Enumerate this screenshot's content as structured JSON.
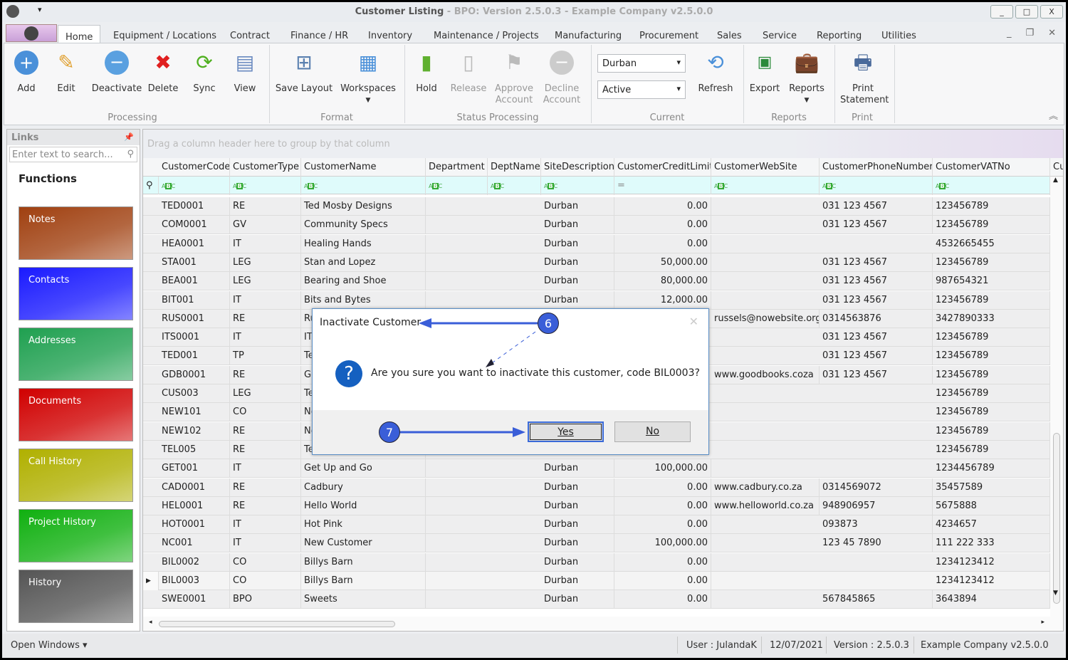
{
  "window": {
    "title": "Customer Listing",
    "subtitle": " - BPO: Version 2.5.0.3 - Example Company v2.5.0.0",
    "minimize": "_",
    "maximize": "□",
    "close": "X"
  },
  "tabs": [
    "Home",
    "Equipment / Locations",
    "Contract",
    "Finance / HR",
    "Inventory",
    "Maintenance / Projects",
    "Manufacturing",
    "Procurement",
    "Sales",
    "Service",
    "Reporting",
    "Utilities"
  ],
  "ribbon": {
    "processing": {
      "label": "Processing",
      "buttons": [
        "Add",
        "Edit",
        "Deactivate",
        "Delete",
        "Sync",
        "View"
      ]
    },
    "format": {
      "label": "Format",
      "buttons": [
        "Save Layout",
        "Workspaces"
      ]
    },
    "status_processing": {
      "label": "Status Processing",
      "buttons": [
        "Hold",
        "Release",
        "Approve Account",
        "Decline Account"
      ]
    },
    "current": {
      "label": "Current",
      "site": "Durban",
      "status": "Active",
      "refresh": "Refresh"
    },
    "reports": {
      "label": "Reports",
      "buttons": [
        "Export",
        "Reports"
      ]
    },
    "print": {
      "label": "Print",
      "buttons": [
        "Print Statement"
      ]
    }
  },
  "links": {
    "title": "Links",
    "search_placeholder": "Enter text to search...",
    "functions_title": "Functions",
    "tiles": [
      {
        "label": "Notes",
        "color": "#a04010"
      },
      {
        "label": "Contacts",
        "color": "#1a1aff"
      },
      {
        "label": "Addresses",
        "color": "#1fa050"
      },
      {
        "label": "Documents",
        "color": "#d00000"
      },
      {
        "label": "Call History",
        "color": "#b0b000"
      },
      {
        "label": "Project History",
        "color": "#10b010"
      },
      {
        "label": "History",
        "color": "#555555"
      }
    ]
  },
  "grid": {
    "group_hint": "Drag a column header here to group by that column",
    "columns": [
      "CustomerCode",
      "CustomerType",
      "CustomerName",
      "Department",
      "DeptName",
      "SiteDescription",
      "CustomerCreditLimit",
      "CustomerWebSite",
      "CustomerPhoneNumber",
      "CustomerVATNo",
      "Cus"
    ],
    "rows": [
      [
        "TED0001",
        "RE",
        "Ted Mosby Designs",
        "",
        "",
        "Durban",
        "0.00",
        "",
        "031 123 4567",
        "123456789"
      ],
      [
        "COM0001",
        "GV",
        "Community Specs",
        "",
        "",
        "Durban",
        "0.00",
        "",
        "031 123 4567",
        "123456789"
      ],
      [
        "HEA0001",
        "IT",
        "Healing Hands",
        "",
        "",
        "Durban",
        "0.00",
        "",
        "",
        "4532665455"
      ],
      [
        "STA001",
        "LEG",
        "Stan and Lopez",
        "",
        "",
        "Durban",
        "50,000.00",
        "",
        "031 123 4567",
        "123456789"
      ],
      [
        "BEA001",
        "LEG",
        "Bearing and Shoe",
        "",
        "",
        "Durban",
        "80,000.00",
        "",
        "031 123 4567",
        "987654321"
      ],
      [
        "BIT001",
        "IT",
        "Bits and Bytes",
        "",
        "",
        "Durban",
        "12,000.00",
        "",
        "031 123 4567",
        "123456789"
      ],
      [
        "RUS0001",
        "RE",
        "Ru",
        "",
        "",
        "",
        "",
        "russels@nowebsite.org",
        "0314563876",
        "3427890333"
      ],
      [
        "ITS0001",
        "IT",
        "IT",
        "",
        "",
        "",
        "",
        "",
        "031 123 4567",
        "123456789"
      ],
      [
        "TED001",
        "TP",
        "Te",
        "",
        "",
        "",
        "",
        "",
        "031 123 4567",
        "123456789"
      ],
      [
        "GDB0001",
        "RE",
        "Go",
        "",
        "",
        "",
        "",
        "www.goodbooks.coza",
        "031 123 4567",
        "123456789"
      ],
      [
        "CUS003",
        "LEG",
        "Te",
        "",
        "",
        "",
        "",
        "",
        "",
        "123456789"
      ],
      [
        "NEW101",
        "CO",
        "Ne",
        "",
        "",
        "",
        "",
        "",
        "",
        "123456789"
      ],
      [
        "NEW102",
        "RE",
        "Ne",
        "",
        "",
        "",
        "",
        "",
        "",
        "123456789"
      ],
      [
        "TEL005",
        "RE",
        "Te",
        "",
        "",
        "",
        "",
        "",
        "",
        "123456789"
      ],
      [
        "GET001",
        "IT",
        "Get Up and Go",
        "",
        "",
        "Durban",
        "100,000.00",
        "",
        "",
        "1234456789"
      ],
      [
        "CAD0001",
        "RE",
        "Cadbury",
        "",
        "",
        "Durban",
        "0.00",
        "www.cadbury.co.za",
        "0314569072",
        "35457589"
      ],
      [
        "HEL0001",
        "RE",
        "Hello World",
        "",
        "",
        "Durban",
        "0.00",
        "www.helloworld.co.za",
        "948906957",
        "5675888"
      ],
      [
        "HOT0001",
        "IT",
        "Hot Pink",
        "",
        "",
        "Durban",
        "0.00",
        "",
        "093873",
        "4234657"
      ],
      [
        "NC001",
        "IT",
        "New Customer",
        "",
        "",
        "Durban",
        "100,000.00",
        "",
        "123 45 7890",
        "111 222 333"
      ],
      [
        "BIL0002",
        "CO",
        "Billys Barn",
        "",
        "",
        "Durban",
        "0.00",
        "",
        "",
        "1234123412"
      ],
      [
        "BIL0003",
        "CO",
        "Billys Barn",
        "",
        "",
        "Durban",
        "0.00",
        "",
        "",
        "1234123412"
      ],
      [
        "SWE0001",
        "BPO",
        "Sweets",
        "",
        "",
        "Durban",
        "0.00",
        "",
        "567845865",
        "3643894"
      ]
    ],
    "current_row": 20
  },
  "dialog": {
    "title": "Inactivate Customer",
    "message": "Are you sure you want to inactivate this customer, code BIL0003?",
    "yes": "Yes",
    "no": "No"
  },
  "callouts": [
    "6",
    "7"
  ],
  "status": {
    "open_windows": "Open Windows ▾",
    "user": "User : JulandaK",
    "date": "12/07/2021",
    "version": "Version : 2.5.0.3",
    "company": "Example Company v2.5.0.0"
  },
  "accent": "#3a5ed8"
}
